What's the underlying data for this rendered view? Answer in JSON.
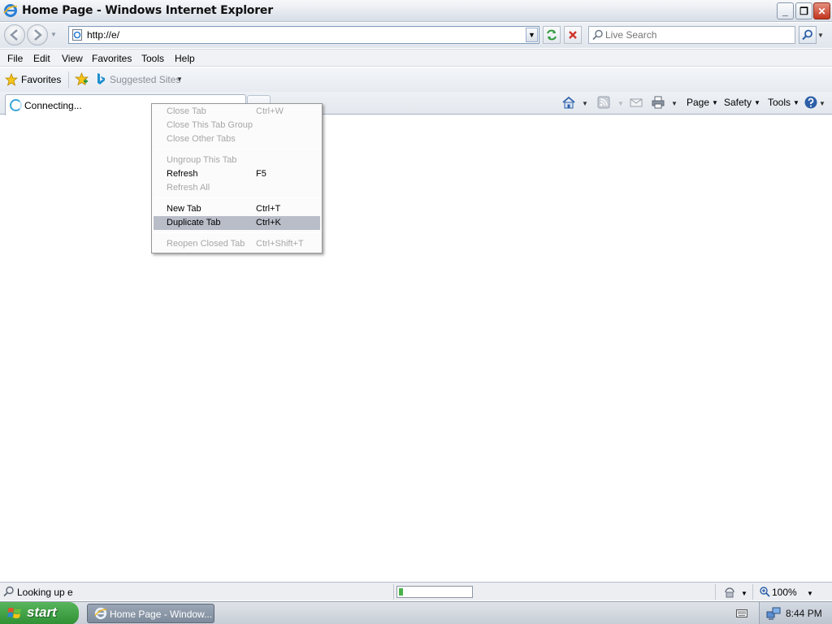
{
  "window": {
    "title": "Home Page - Windows Internet Explorer",
    "buttons": {
      "minimize": "_",
      "restore": "❐",
      "close": "✕"
    }
  },
  "navbar": {
    "address_url": "http://e/",
    "search_placeholder": "Live Search"
  },
  "menubar": {
    "items": [
      "File",
      "Edit",
      "View",
      "Favorites",
      "Tools",
      "Help"
    ]
  },
  "favorites_bar": {
    "favorites_label": "Favorites",
    "suggested_sites_label": "Suggested Sites"
  },
  "tab": {
    "label": "Connecting..."
  },
  "command_bar": {
    "page_label": "Page",
    "safety_label": "Safety",
    "tools_label": "Tools"
  },
  "context_menu": {
    "items": [
      {
        "label": "Close Tab",
        "shortcut": "Ctrl+W",
        "state": "disabled"
      },
      {
        "label": "Close This Tab Group",
        "shortcut": "",
        "state": "disabled"
      },
      {
        "label": "Close Other Tabs",
        "shortcut": "",
        "state": "disabled"
      },
      {
        "label": "Ungroup This Tab",
        "shortcut": "",
        "state": "disabled"
      },
      {
        "label": "Refresh",
        "shortcut": "F5",
        "state": "enabled"
      },
      {
        "label": "Refresh All",
        "shortcut": "",
        "state": "disabled"
      },
      {
        "label": "New Tab",
        "shortcut": "Ctrl+T",
        "state": "enabled"
      },
      {
        "label": "Duplicate Tab",
        "shortcut": "Ctrl+K",
        "state": "highlighted"
      },
      {
        "label": "Reopen Closed Tab",
        "shortcut": "Ctrl+Shift+T",
        "state": "disabled"
      }
    ]
  },
  "statusbar": {
    "text": "Looking up e",
    "progress_fraction": 0.06,
    "zoom": "100%"
  },
  "taskbar": {
    "start_label": "start",
    "task_label": "Home Page - Window...",
    "clock": "8:44 PM"
  }
}
